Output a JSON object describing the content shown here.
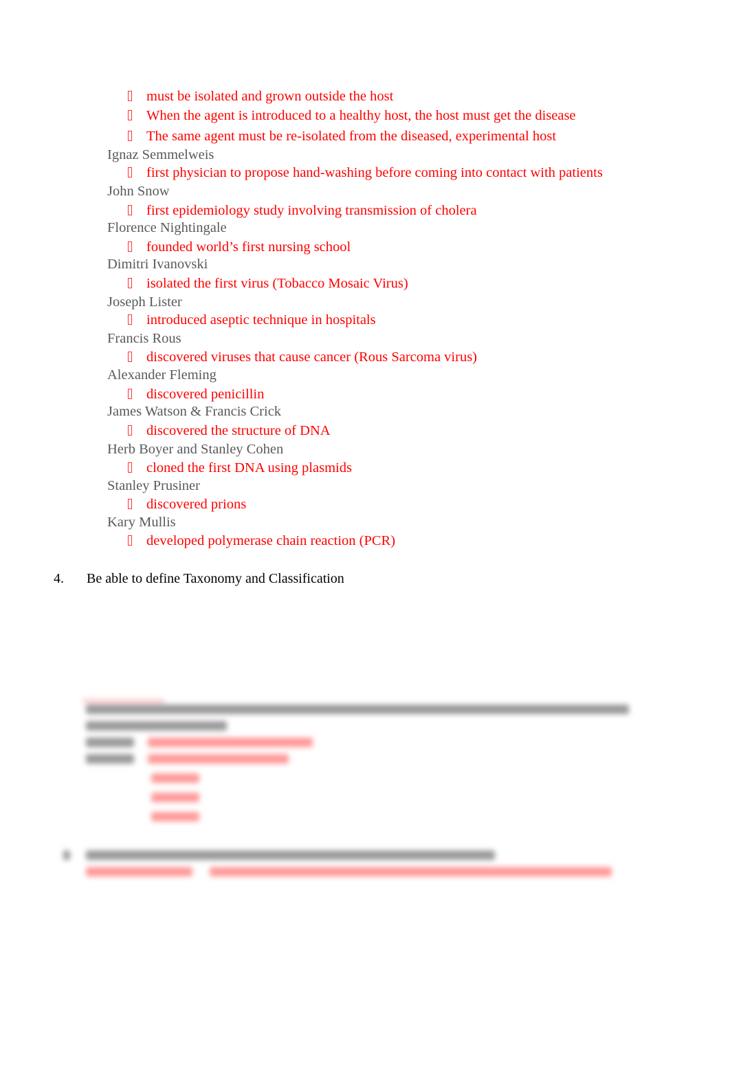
{
  "document": {
    "intro_bullets": [
      "must be isolated and grown outside the host",
      "When the agent is introduced to a healthy host, the host must get the disease",
      "The same agent must be re-isolated from the diseased, experimental host"
    ],
    "scientists": [
      {
        "name": "Ignaz Semmelweis",
        "contribution": "first physician to propose hand-washing before coming into contact with patients"
      },
      {
        "name": "John Snow",
        "contribution": "first epidemiology study involving transmission of cholera"
      },
      {
        "name": "Florence Nightingale",
        "contribution": "founded world’s first nursing school"
      },
      {
        "name": "Dimitri Ivanovski",
        "contribution": "isolated the first virus (Tobacco Mosaic Virus)"
      },
      {
        "name": "Joseph Lister",
        "contribution": "introduced aseptic technique in hospitals"
      },
      {
        "name": "Francis Rous",
        "contribution": "discovered viruses that cause cancer (Rous Sarcoma virus)"
      },
      {
        "name": "Alexander Fleming",
        "contribution": "discovered penicillin"
      },
      {
        "name": "James Watson & Francis Crick",
        "contribution": "discovered the structure of DNA"
      },
      {
        "name": "Herb Boyer and Stanley Cohen",
        "contribution": "cloned the first DNA using plasmids"
      },
      {
        "name": "Stanley Prusiner",
        "contribution": "discovered prions"
      },
      {
        "name": "Kary Mullis",
        "contribution": "developed polymerase chain reaction (PCR)"
      }
    ],
    "question_4": {
      "number": "4.",
      "text": "Be able to define Taxonomy and Classification"
    },
    "bullet_icon": "missing-glyph-box-icon",
    "colors": {
      "answer_text": "#ff0000",
      "name_text": "#595959",
      "question_text": "#000000"
    }
  }
}
